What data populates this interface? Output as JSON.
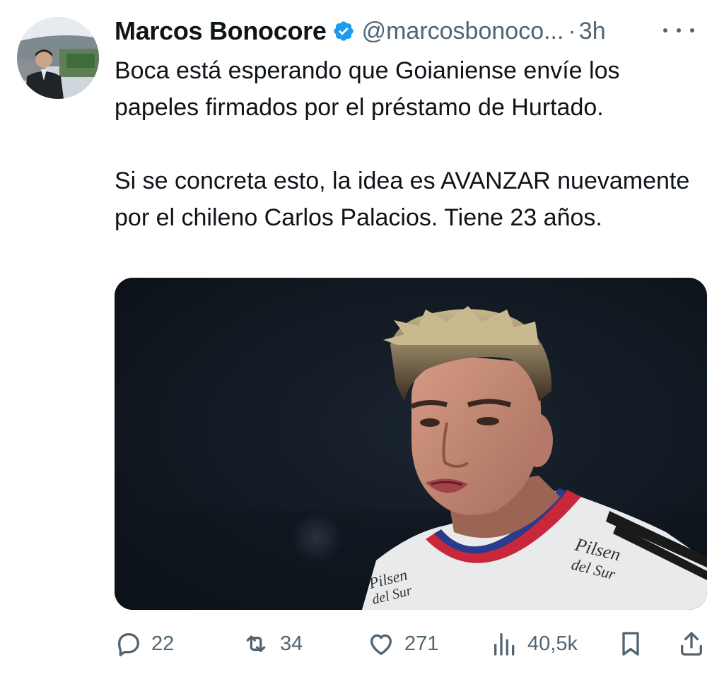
{
  "tweet": {
    "author": {
      "display_name": "Marcos Bonocore",
      "handle": "@marcosbonoco...",
      "verified": true,
      "avatar_icon": "profile-photo"
    },
    "separator": "·",
    "timestamp": "3h",
    "text_paragraphs": [
      "Boca está esperando que Goianiense envíe los papeles firmados por el préstamo de Hurtado.",
      "Si se concreta esto, la idea es AVANZAR nuevamente por el chileno Carlos Palacios. Tiene 23 años."
    ],
    "media": {
      "jersey_text_1": "Pilsen",
      "jersey_text_2": "del Sur"
    },
    "actions": {
      "replies": "22",
      "retweets": "34",
      "likes": "271",
      "views": "40,5k"
    }
  },
  "colors": {
    "text_primary": "#0f1419",
    "text_secondary": "#536471",
    "verified_blue": "#1d9bf0"
  }
}
